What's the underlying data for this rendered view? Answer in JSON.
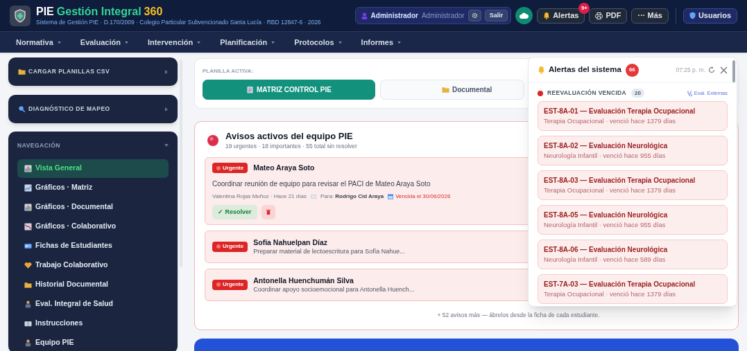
{
  "app": {
    "title_prefix": "PIE",
    "title_main": "Gestión Integral",
    "title_suffix": "360",
    "subtitle": "Sistema de Gestión PIE · D.170/2009 · Colegio Particular Subvencionado Santa Lucía · RBD 12847-6 · 2026"
  },
  "user": {
    "name": "Administrador",
    "role": "Administrador",
    "logout": "Salir"
  },
  "toolbar": {
    "alerts": "Alertas",
    "alerts_badge": "9+",
    "pdf": "PDF",
    "more": "··· Más",
    "users": "Usuarios"
  },
  "menu": [
    {
      "label": "Normativa"
    },
    {
      "label": "Evaluación"
    },
    {
      "label": "Intervención"
    },
    {
      "label": "Planificación"
    },
    {
      "label": "Protocolos"
    },
    {
      "label": "Informes"
    }
  ],
  "sidebar": {
    "panels": [
      {
        "label": "CARGAR PLANILLAS CSV"
      },
      {
        "label": "DIAGNÓSTICO DE MAPEO"
      }
    ],
    "nav_title": "NAVEGACIÓN",
    "items": [
      {
        "label": "Vista General",
        "selected": true
      },
      {
        "label": "Gráficos · Matriz",
        "selected": false
      },
      {
        "label": "Gráficos · Documental",
        "selected": false
      },
      {
        "label": "Gráficos · Colaborativo",
        "selected": false
      },
      {
        "label": "Fichas de Estudiantes",
        "selected": false
      },
      {
        "label": "Trabajo Colaborativo",
        "selected": false
      },
      {
        "label": "Historial Documental",
        "selected": false
      },
      {
        "label": "Eval. Integral de Salud",
        "selected": false
      },
      {
        "label": "Instrucciones",
        "selected": false
      },
      {
        "label": "Equipo PIE",
        "selected": false
      }
    ]
  },
  "sheet": {
    "label": "PLANILLA ACTIVA:",
    "tabs": [
      {
        "label": "MATRIZ CONTROL PIE",
        "selected": true
      },
      {
        "label": "Documental",
        "selected": false
      }
    ]
  },
  "notices": {
    "title": "Avisos activos del equipo PIE",
    "summary": "19 urgentes · 18 importantes · 55 total sin resolver",
    "items": [
      {
        "badge": "Urgente",
        "student": "Mateo Araya Soto",
        "text": "Coordinar reunión de equipo para revisar el PACI de Mateo Araya Soto",
        "expanded": true,
        "author": "Valentina Rojas Muñoz · Hace 21 días",
        "to_label": "Para:",
        "to": "Rodrigo Cid Araya",
        "due": "Vencida el 30/06/2026",
        "resolve": "✓ Resolver"
      },
      {
        "badge": "Urgente",
        "student": "Sofía Nahuelpan Díaz",
        "text": "Preparar material de lectoescritura para Sofía Nahue...",
        "expanded": false
      },
      {
        "badge": "Urgente",
        "student": "Antonella Huenchumán Silva",
        "text": "Coordinar apoyo socioemocional para Antonella Huench...",
        "expanded": false
      }
    ],
    "more": "+ 52 avisos más — ábrelos desde la ficha de cada estudiante."
  },
  "alerts_panel": {
    "title": "Alertas del sistema",
    "count": "66",
    "time": "07:25 p. m.",
    "section": {
      "title": "REEVALUACIÓN VENCIDA",
      "count": "20",
      "link": "Eval. Externas"
    },
    "items": [
      {
        "title": "EST-8A-01 — Evaluación Terapia Ocupacional",
        "detail": "Terapia Ocupacional · venció hace 1379 días"
      },
      {
        "title": "EST-8A-02 — Evaluación Neurológica",
        "detail": "Neurología Infantil · venció hace 955 días"
      },
      {
        "title": "EST-8A-03 — Evaluación Terapia Ocupacional",
        "detail": "Terapia Ocupacional · venció hace 1379 días"
      },
      {
        "title": "EST-8A-05 — Evaluación Neurológica",
        "detail": "Neurología Infantil · venció hace 955 días"
      },
      {
        "title": "EST-8A-06 — Evaluación Neurológica",
        "detail": "Neurología Infantil · venció hace 589 días"
      },
      {
        "title": "EST-7A-03 — Evaluación Terapia Ocupacional",
        "detail": "Terapia Ocupacional · venció hace 1379 días"
      }
    ]
  }
}
